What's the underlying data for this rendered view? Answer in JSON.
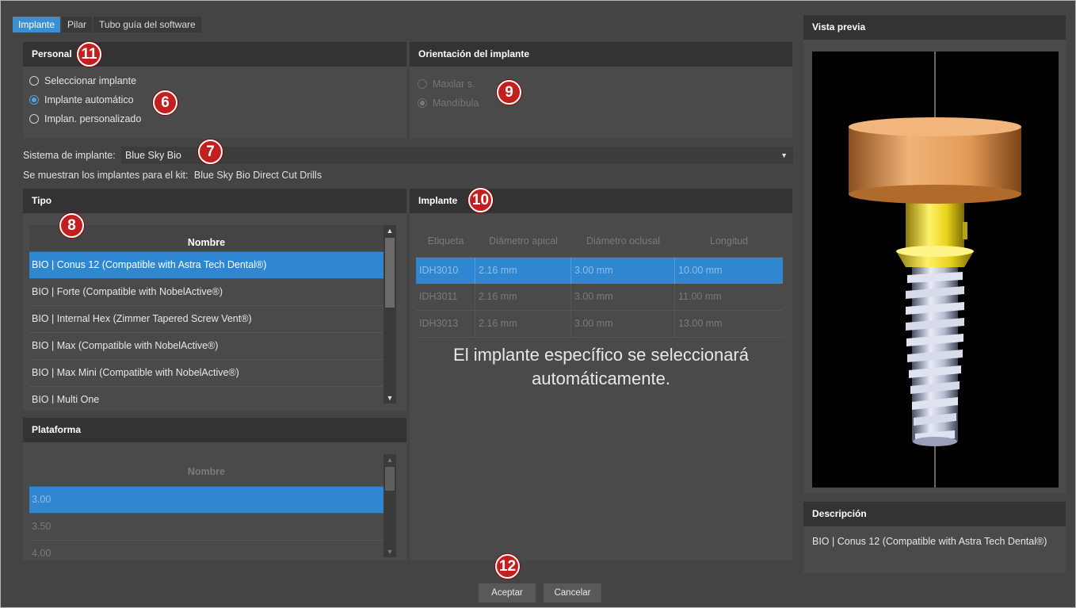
{
  "tabs": [
    "Implante",
    "Pilar",
    "Tubo guía del software"
  ],
  "personal": {
    "title": "Personal",
    "options": [
      "Seleccionar implante",
      "Implante automático",
      "Implan. personalizado"
    ]
  },
  "orientacion": {
    "title": "Orientación del implante",
    "options": [
      "Maxilar s.",
      "Mandíbula"
    ]
  },
  "sistema": {
    "label": "Sistema de implante:",
    "value": "Blue Sky Bio",
    "kit_label": "Se muestran los implantes para el kit:",
    "kit_value": "Blue Sky Bio Direct Cut Drills"
  },
  "tipo": {
    "title": "Tipo",
    "column": "Nombre",
    "rows": [
      "BIO | Conus 12 (Compatible with Astra Tech Dental®)",
      "BIO | Forte (Compatible with NobelActive®)",
      "BIO | Internal Hex (Zimmer Tapered Screw Vent®)",
      "BIO | Max (Compatible with NobelActive®)",
      "BIO | Max Mini (Compatible with NobelActive®)",
      "BIO | Multi One"
    ]
  },
  "plataforma": {
    "title": "Plataforma",
    "column": "Nombre",
    "rows": [
      "3.00",
      "3.50",
      "4.00"
    ]
  },
  "implante": {
    "title": "Implante",
    "columns": [
      "Etiqueta",
      "Diámetro apical",
      "Diámetro oclusal",
      "Longitud"
    ],
    "rows": [
      [
        "IDH3010",
        "2.16 mm",
        "3.00 mm",
        "10.00 mm"
      ],
      [
        "IDH3011",
        "2.16 mm",
        "3.00 mm",
        "11.00 mm"
      ],
      [
        "IDH3013",
        "2.16 mm",
        "3.00 mm",
        "13.00 mm"
      ]
    ],
    "message": "El implante específico se seleccionará automáticamente."
  },
  "preview": {
    "title": "Vista previa"
  },
  "descripcion": {
    "title": "Descripción",
    "text": "BIO | Conus 12 (Compatible with Astra Tech Dental®)"
  },
  "buttons": {
    "accept": "Aceptar",
    "cancel": "Cancelar"
  },
  "callouts": [
    "11",
    "6",
    "9",
    "7",
    "8",
    "10",
    "12"
  ],
  "colors": {
    "accent": "#2f86d1",
    "callout": "#c41f1f",
    "abutment": "#e6a35a",
    "collar": "#e8d21a"
  }
}
